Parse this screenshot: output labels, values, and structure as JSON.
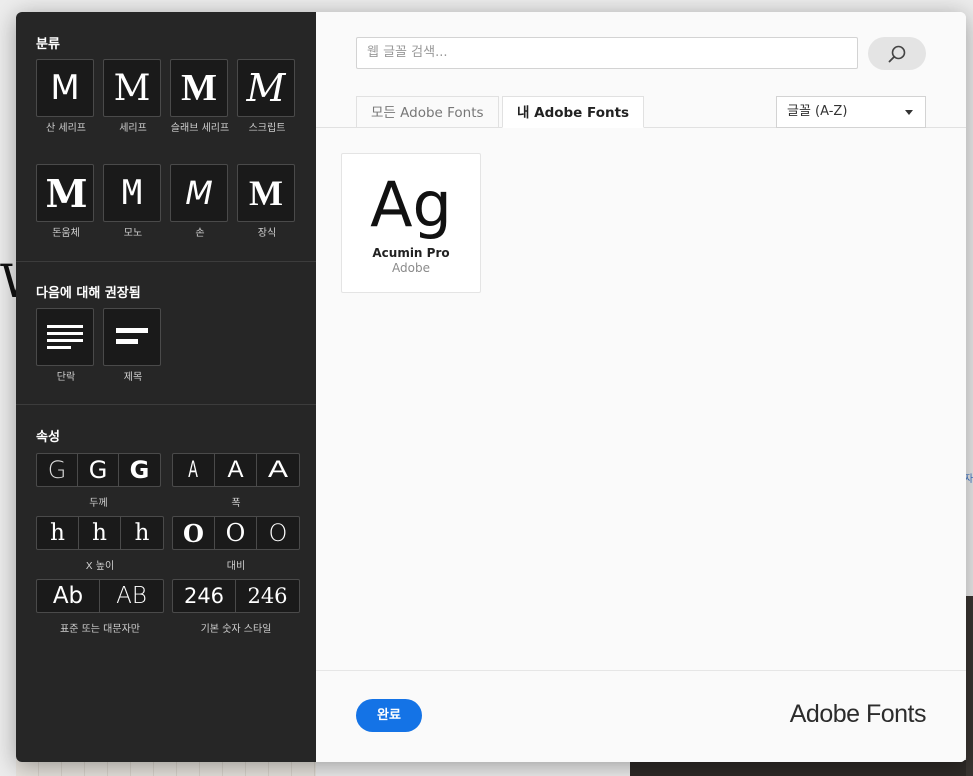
{
  "background": {
    "partial_letter": "W",
    "side_text": "자"
  },
  "sidebar": {
    "classification_title": "분류",
    "categories": [
      {
        "glyph": "M",
        "label": "산 세리프"
      },
      {
        "glyph": "M",
        "label": "세리프"
      },
      {
        "glyph": "M",
        "label": "슬래브 세리프"
      },
      {
        "glyph": "M",
        "label": "스크립트"
      },
      {
        "glyph": "M",
        "label": "돈움체"
      },
      {
        "glyph": "M",
        "label": "모노"
      },
      {
        "glyph": "M",
        "label": "손"
      },
      {
        "glyph": "M",
        "label": "장식"
      }
    ],
    "recommended_title": "다음에 대해 권장됨",
    "recommended": [
      {
        "label": "단락"
      },
      {
        "label": "제목"
      }
    ],
    "properties_title": "속성",
    "weight": {
      "cells": [
        "G",
        "G",
        "G"
      ],
      "label": "두께"
    },
    "width": {
      "cells": [
        "A",
        "A",
        "A"
      ],
      "label": "폭"
    },
    "xheight": {
      "cells": [
        "h",
        "h",
        "h"
      ],
      "label": "X 높이"
    },
    "contrast": {
      "cells": [
        "O",
        "O",
        "O"
      ],
      "label": "대비"
    },
    "case": {
      "cells": [
        "Ab",
        "AB"
      ],
      "label": "표준 또는 대문자만"
    },
    "numerals": {
      "cells": [
        "246",
        "246"
      ],
      "label": "기본 숫자 스타일"
    }
  },
  "main": {
    "search_placeholder": "웹 글꼴 검색...",
    "tabs": [
      {
        "label": "모든 Adobe Fonts",
        "active": false
      },
      {
        "label": "내 Adobe Fonts",
        "active": true
      }
    ],
    "sort_selected": "글꼴 (A-Z)",
    "fonts": [
      {
        "sample": "Ag",
        "name": "Acumin Pro",
        "foundry": "Adobe"
      }
    ],
    "done_label": "완료",
    "brand": "Adobe Fonts"
  },
  "colors": {
    "accent": "#1473e6",
    "sidebar_bg": "#262626"
  }
}
